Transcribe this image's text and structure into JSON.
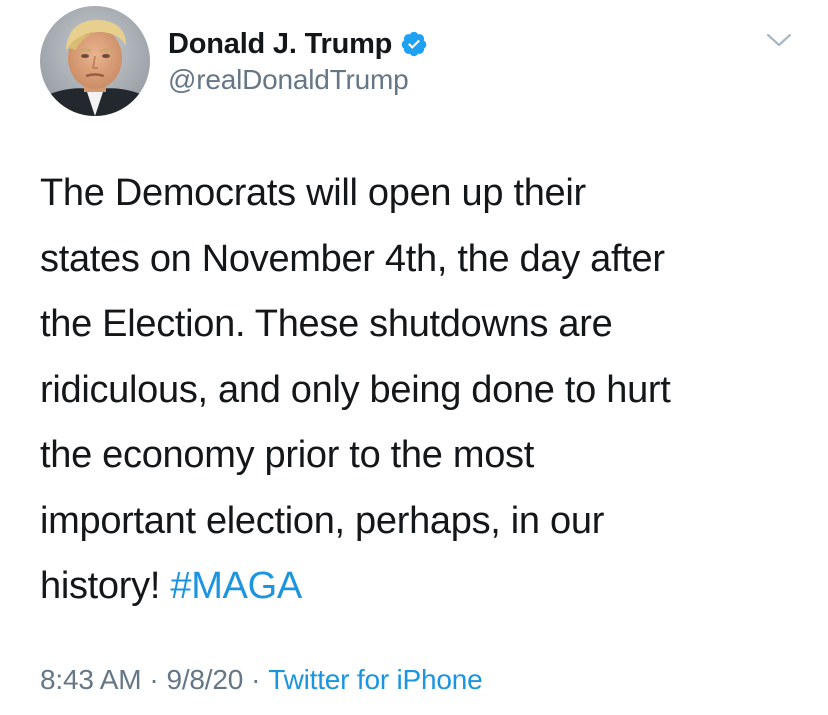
{
  "author": {
    "display_name": "Donald J. Trump",
    "handle": "@realDonaldTrump",
    "verified": true,
    "avatar": "profile-photo"
  },
  "menu": {
    "icon": "chevron-down-icon"
  },
  "tweet": {
    "lines": [
      "The Democrats will open up their",
      "states on November 4th, the day after",
      "the Election. These shutdowns are",
      "ridiculous, and only being done to hurt",
      "the economy prior to the most",
      "important election, perhaps, in our",
      "history!"
    ],
    "hashtag": "#MAGA"
  },
  "meta": {
    "time": "8:43 AM",
    "separator": "·",
    "date": "9/8/20",
    "source": "Twitter for iPhone"
  },
  "colors": {
    "text": "#14171a",
    "secondary": "#657786",
    "link": "#1b95e0",
    "verified_badge": "#1da1f2"
  }
}
